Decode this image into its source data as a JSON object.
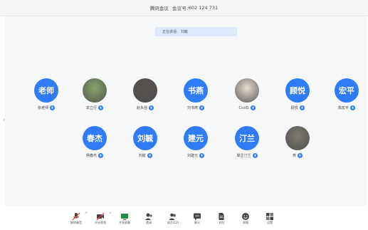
{
  "title": {
    "app": "腾讯会议",
    "meeting_label": "会议号:",
    "meeting_id": "602 124 731"
  },
  "speaking": {
    "label": "正在讲话:",
    "name": "刘毓"
  },
  "participants": [
    {
      "avatar_text": "老师",
      "name": "张老师",
      "photo": false
    },
    {
      "avatar_text": "",
      "name": "袁立行",
      "photo": true,
      "photo_color": "#8aa56b"
    },
    {
      "avatar_text": "",
      "name": "赵永强",
      "photo": true,
      "photo_color": "#5a5450"
    },
    {
      "avatar_text": "书燕",
      "name": "刘书燕",
      "photo": false
    },
    {
      "avatar_text": "",
      "name": "Cici石",
      "photo": true,
      "photo_color": "#e8ddd2"
    },
    {
      "avatar_text": "顾悦",
      "name": "顾悦",
      "photo": false
    },
    {
      "avatar_text": "宏平",
      "name": "陈宏平",
      "photo": false
    },
    {
      "avatar_text": "春杰",
      "name": "杨春杰",
      "photo": false
    },
    {
      "avatar_text": "刘毓",
      "name": "刘毓",
      "photo": false
    },
    {
      "avatar_text": "建元",
      "name": "刘建元",
      "photo": false
    },
    {
      "avatar_text": "汀兰",
      "name": "岸芷汀兰",
      "photo": false
    },
    {
      "avatar_text": "",
      "name": "燕",
      "photo": true,
      "photo_color": "#7d7a6e"
    }
  ],
  "toolbar": [
    {
      "label": "解除静音",
      "icon": "mic-muted-icon"
    },
    {
      "label": "开启视频",
      "icon": "video-off-icon"
    },
    {
      "label": "共享屏幕",
      "icon": "share-screen-icon"
    },
    {
      "label": "邀请",
      "icon": "invite-icon"
    },
    {
      "label": "成员(12)",
      "icon": "members-icon"
    },
    {
      "label": "聊天",
      "icon": "chat-icon"
    },
    {
      "label": "文档",
      "icon": "document-icon"
    },
    {
      "label": "表情",
      "icon": "emoji-icon"
    },
    {
      "label": "设置",
      "icon": "settings-icon"
    }
  ],
  "colors": {
    "accent": "#2f7cf6",
    "speaking_bg": "#dde9fb"
  }
}
